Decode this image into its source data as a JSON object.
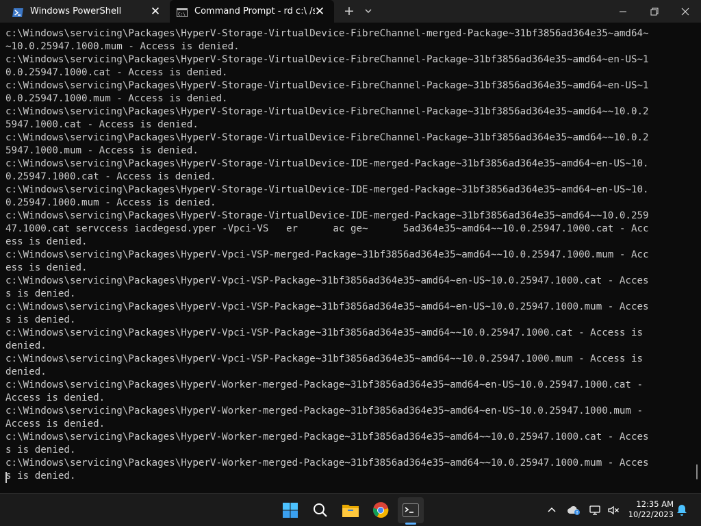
{
  "tabs": [
    {
      "title": "Windows PowerShell",
      "close_icon": "close-icon"
    },
    {
      "title": "Command Prompt - rd  c:\\ /s /",
      "close_icon": "close-icon"
    }
  ],
  "window_controls": [
    "minimize-icon",
    "maximize-icon",
    "close-icon"
  ],
  "terminal": {
    "lines": [
      "c:\\Windows\\servicing\\Packages\\HyperV-Storage-VirtualDevice-FibreChannel-merged-Package~31bf3856ad364e35~amd64~",
      "~10.0.25947.1000.mum - Access is denied.",
      "c:\\Windows\\servicing\\Packages\\HyperV-Storage-VirtualDevice-FibreChannel-Package~31bf3856ad364e35~amd64~en-US~1",
      "0.0.25947.1000.cat - Access is denied.",
      "c:\\Windows\\servicing\\Packages\\HyperV-Storage-VirtualDevice-FibreChannel-Package~31bf3856ad364e35~amd64~en-US~1",
      "0.0.25947.1000.mum - Access is denied.",
      "c:\\Windows\\servicing\\Packages\\HyperV-Storage-VirtualDevice-FibreChannel-Package~31bf3856ad364e35~amd64~~10.0.2",
      "5947.1000.cat - Access is denied.",
      "c:\\Windows\\servicing\\Packages\\HyperV-Storage-VirtualDevice-FibreChannel-Package~31bf3856ad364e35~amd64~~10.0.2",
      "5947.1000.mum - Access is denied.",
      "c:\\Windows\\servicing\\Packages\\HyperV-Storage-VirtualDevice-IDE-merged-Package~31bf3856ad364e35~amd64~en-US~10.",
      "0.25947.1000.cat - Access is denied.",
      "c:\\Windows\\servicing\\Packages\\HyperV-Storage-VirtualDevice-IDE-merged-Package~31bf3856ad364e35~amd64~en-US~10.",
      "0.25947.1000.mum - Access is denied.",
      "c:\\Windows\\servicing\\Packages\\HyperV-Storage-VirtualDevice-IDE-merged-Package~31bf3856ad364e35~amd64~~10.0.259",
      "47.1000.cat servccess iacdegesd.yper -Vpci-VS   er      ac ge~      5ad364e35~amd64~~10.0.25947.1000.cat - Acc",
      "ess is denied.",
      "c:\\Windows\\servicing\\Packages\\HyperV-Vpci-VSP-merged-Package~31bf3856ad364e35~amd64~~10.0.25947.1000.mum - Acc",
      "ess is denied.",
      "c:\\Windows\\servicing\\Packages\\HyperV-Vpci-VSP-Package~31bf3856ad364e35~amd64~en-US~10.0.25947.1000.cat - Acces",
      "s is denied.",
      "c:\\Windows\\servicing\\Packages\\HyperV-Vpci-VSP-Package~31bf3856ad364e35~amd64~en-US~10.0.25947.1000.mum - Acces",
      "s is denied.",
      "c:\\Windows\\servicing\\Packages\\HyperV-Vpci-VSP-Package~31bf3856ad364e35~amd64~~10.0.25947.1000.cat - Access is",
      "denied.",
      "c:\\Windows\\servicing\\Packages\\HyperV-Vpci-VSP-Package~31bf3856ad364e35~amd64~~10.0.25947.1000.mum - Access is",
      "denied.",
      "c:\\Windows\\servicing\\Packages\\HyperV-Worker-merged-Package~31bf3856ad364e35~amd64~en-US~10.0.25947.1000.cat -",
      "Access is denied.",
      "c:\\Windows\\servicing\\Packages\\HyperV-Worker-merged-Package~31bf3856ad364e35~amd64~en-US~10.0.25947.1000.mum -",
      "Access is denied.",
      "c:\\Windows\\servicing\\Packages\\HyperV-Worker-merged-Package~31bf3856ad364e35~amd64~~10.0.25947.1000.cat - Acces",
      "s is denied.",
      "c:\\Windows\\servicing\\Packages\\HyperV-Worker-merged-Package~31bf3856ad364e35~amd64~~10.0.25947.1000.mum - Acces",
      "s is denied."
    ]
  },
  "taskbar": {
    "apps": [
      "windows-start-icon",
      "search-icon",
      "file-explorer-icon",
      "chrome-icon",
      "terminal-icon"
    ],
    "tray": [
      "chevron-up-icon",
      "weather-icon",
      "network-icon",
      "volume-muted-icon"
    ],
    "time": "12:35 AM",
    "date": "10/22/2023",
    "notification_icon": "bell-icon"
  },
  "colors": {
    "tabbar_bg": "#202020",
    "terminal_bg": "#0c0c0c",
    "terminal_text": "#cccccc",
    "taskbar_bg": "#1b1b1b",
    "accent": "#5bb0ff"
  }
}
